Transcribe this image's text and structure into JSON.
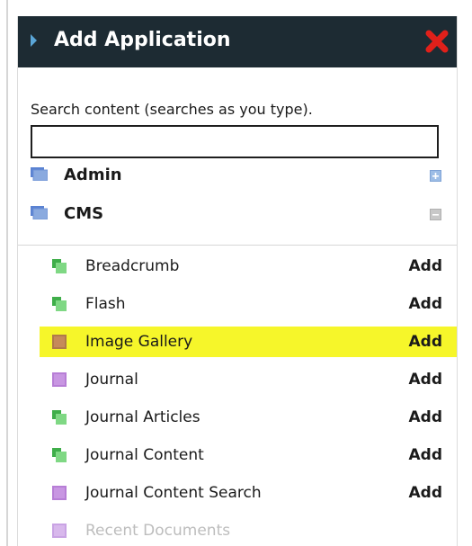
{
  "dialog": {
    "title": "Add Application",
    "close_icon": "close-x-icon",
    "close_color": "#e0201a",
    "header_color": "#1d2b33"
  },
  "search": {
    "label": "Search content (searches as you type).",
    "value": "",
    "placeholder": ""
  },
  "categories": [
    {
      "label": "Admin",
      "state": "collapsed",
      "toggle_icon": "expand-plus-icon"
    },
    {
      "label": "CMS",
      "state": "expanded",
      "toggle_icon": "collapse-minus-icon"
    }
  ],
  "applications": [
    {
      "label": "Breadcrumb",
      "icon": "green-app-icon",
      "action": "Add",
      "highlighted": false,
      "disabled": false
    },
    {
      "label": "Flash",
      "icon": "green-app-icon",
      "action": "Add",
      "highlighted": false,
      "disabled": false
    },
    {
      "label": "Image Gallery",
      "icon": "purple-app-icon",
      "action": "Add",
      "highlighted": true,
      "disabled": false
    },
    {
      "label": "Journal",
      "icon": "purple-app-icon",
      "action": "Add",
      "highlighted": false,
      "disabled": false
    },
    {
      "label": "Journal Articles",
      "icon": "green-app-icon",
      "action": "Add",
      "highlighted": false,
      "disabled": false
    },
    {
      "label": "Journal Content",
      "icon": "green-app-icon",
      "action": "Add",
      "highlighted": false,
      "disabled": false
    },
    {
      "label": "Journal Content Search",
      "icon": "purple-app-icon",
      "action": "Add",
      "highlighted": false,
      "disabled": false
    },
    {
      "label": "Recent Documents",
      "icon": "purple-app-icon",
      "action": "",
      "highlighted": false,
      "disabled": true
    }
  ],
  "colors": {
    "highlight": "#f6f62a",
    "green_icon": "#59c35f",
    "purple_icon": "#b77ed6",
    "category_icon": "#6f93d6"
  }
}
